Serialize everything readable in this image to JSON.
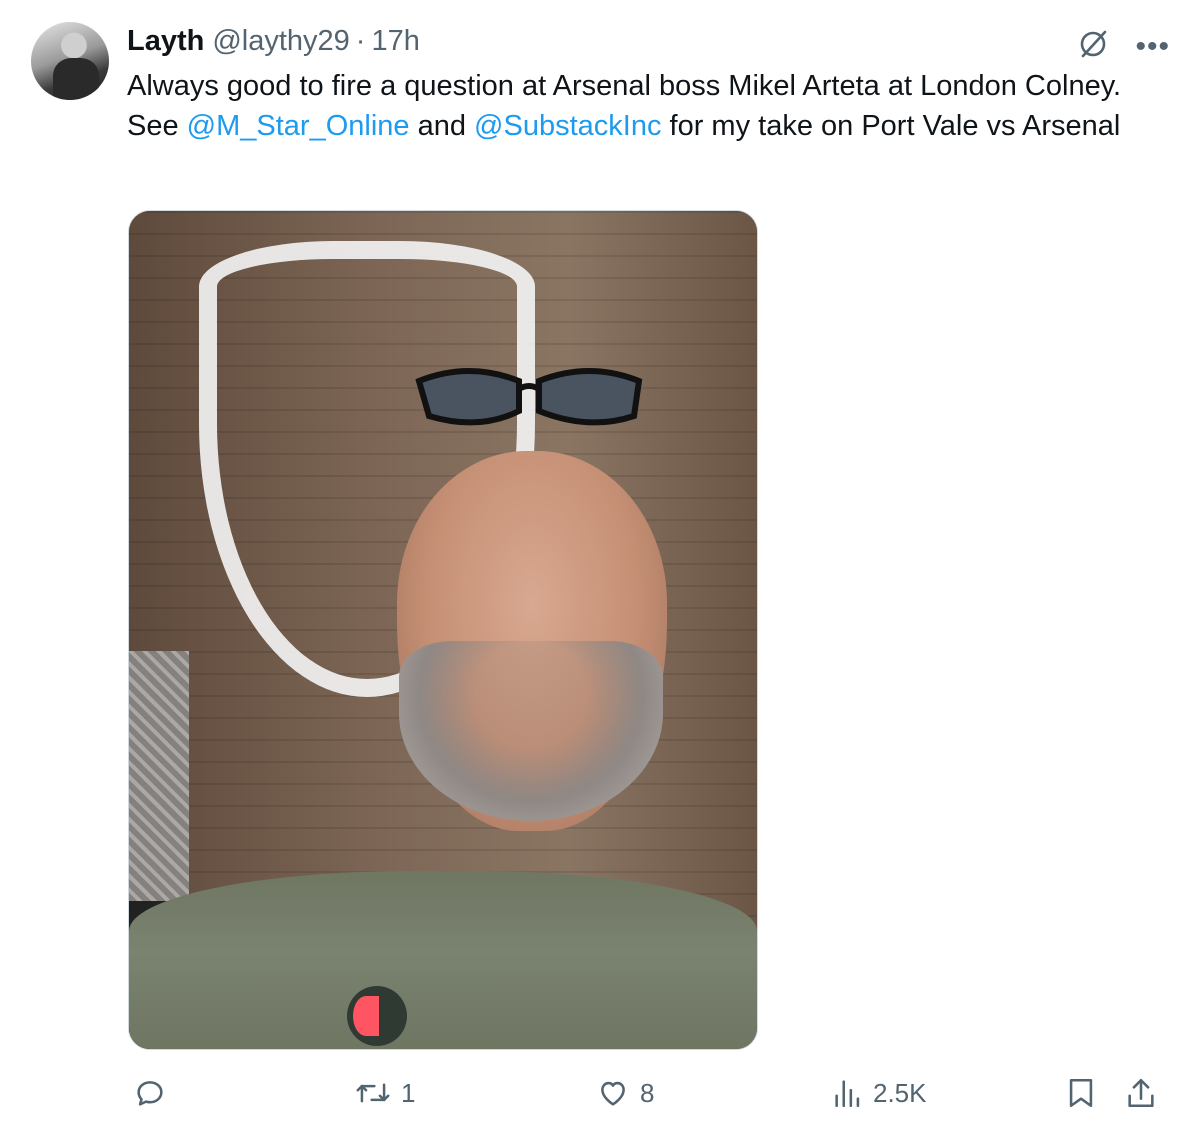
{
  "tweet": {
    "author_name": "Layth",
    "author_handle": "@laythy29",
    "separator": "·",
    "time": "17h",
    "text_parts": [
      "Always good to fire a question at Arsenal boss Mikel Arteta at London Colney. See ",
      "@M_Star_Online",
      " and ",
      "@SubstackInc",
      " for my take on Port Vale vs Arsenal"
    ]
  },
  "media": {
    "type": "photo"
  },
  "actions": {
    "reply_count": "",
    "retweet_count": "1",
    "like_count": "8",
    "views_count": "2.5K"
  },
  "icons": {
    "grok": "grok-icon",
    "more": "more-icon",
    "reply": "reply-icon",
    "retweet": "retweet-icon",
    "like": "heart-icon",
    "views": "views-icon",
    "bookmark": "bookmark-icon",
    "share": "share-icon"
  },
  "colors": {
    "mention": "#1d9bf0",
    "secondary_text": "#536471",
    "primary_text": "#0f1419"
  }
}
